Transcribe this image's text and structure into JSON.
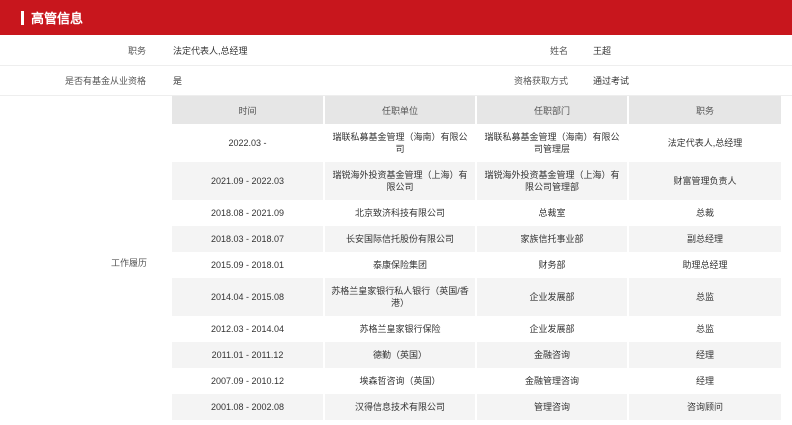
{
  "header": {
    "title": "高管信息"
  },
  "info": {
    "position_label": "职务",
    "position_value": "法定代表人,总经理",
    "name_label": "姓名",
    "name_value": "王超",
    "qual_label": "是否有基金从业资格",
    "qual_value": "是",
    "method_label": "资格获取方式",
    "method_value": "通过考试"
  },
  "work": {
    "label": "工作履历",
    "headers": [
      "时间",
      "任职单位",
      "任职部门",
      "职务"
    ],
    "rows": [
      [
        "2022.03 -",
        "瑞联私募基金管理（海南）有限公司",
        "瑞联私募基金管理（海南）有限公司管理层",
        "法定代表人,总经理"
      ],
      [
        "2021.09 - 2022.03",
        "瑞锐海外投资基金管理（上海）有限公司",
        "瑞锐海外投资基金管理（上海）有限公司管理部",
        "财富管理负责人"
      ],
      [
        "2018.08 - 2021.09",
        "北京致济科技有限公司",
        "总裁室",
        "总裁"
      ],
      [
        "2018.03 - 2018.07",
        "长安国际信托股份有限公司",
        "家族信托事业部",
        "副总经理"
      ],
      [
        "2015.09 - 2018.01",
        "泰康保险集团",
        "财务部",
        "助理总经理"
      ],
      [
        "2014.04 - 2015.08",
        "苏格兰皇家银行私人银行（英国/香港）",
        "企业发展部",
        "总监"
      ],
      [
        "2012.03 - 2014.04",
        "苏格兰皇家银行保险",
        "企业发展部",
        "总监"
      ],
      [
        "2011.01 - 2011.12",
        "德勤（英国）",
        "金融咨询",
        "经理"
      ],
      [
        "2007.09 - 2010.12",
        "埃森哲咨询（英国）",
        "金融管理咨询",
        "经理"
      ],
      [
        "2001.08 - 2002.08",
        "汉得信息技术有限公司",
        "管理咨询",
        "咨询顾问"
      ]
    ]
  }
}
